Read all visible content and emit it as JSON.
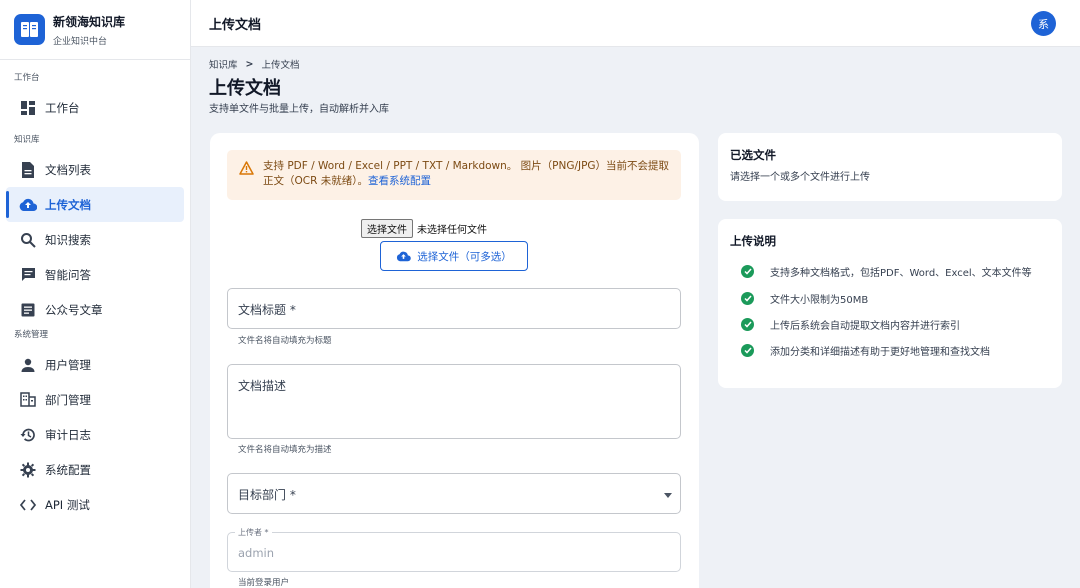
{
  "brand": {
    "name": "新领海知识库",
    "subtitle": "企业知识中台"
  },
  "sidebar": {
    "sections": [
      {
        "label": "工作台"
      },
      {
        "label": "知识库"
      },
      {
        "label": "系统管理"
      }
    ],
    "items": [
      {
        "label": "工作台",
        "icon": "dashboard-icon"
      },
      {
        "label": "文档列表",
        "icon": "document-icon"
      },
      {
        "label": "上传文档",
        "icon": "cloud-upload-icon",
        "active": true
      },
      {
        "label": "知识搜索",
        "icon": "search-icon"
      },
      {
        "label": "智能问答",
        "icon": "chat-icon"
      },
      {
        "label": "公众号文章",
        "icon": "article-icon"
      },
      {
        "label": "用户管理",
        "icon": "person-icon"
      },
      {
        "label": "部门管理",
        "icon": "building-icon"
      },
      {
        "label": "审计日志",
        "icon": "history-icon"
      },
      {
        "label": "系统配置",
        "icon": "gear-icon"
      },
      {
        "label": "API 测试",
        "icon": "code-icon"
      }
    ]
  },
  "topbar": {
    "title": "上传文档",
    "avatar": "系"
  },
  "breadcrumb": {
    "root": "知识库",
    "separator": ">",
    "current": "上传文档"
  },
  "page": {
    "title": "上传文档",
    "subtitle": "支持单文件与批量上传，自动解析并入库"
  },
  "alert": {
    "text": "支持 PDF / Word / Excel / PPT / TXT / Markdown。 图片（PNG/JPG）当前不会提取正文（OCR 未就绪）。",
    "link": "查看系统配置",
    "icon": "warning-icon"
  },
  "upload": {
    "native_button": "选择文件",
    "native_status": "未选择任何文件",
    "pick_button": "选择文件（可多选）"
  },
  "form": {
    "title_label": "文档标题 *",
    "title_helper": "文件名将自动填充为标题",
    "desc_label": "文档描述",
    "desc_helper": "文件名将自动填充为描述",
    "dept_label": "目标部门 *",
    "uploader_label": "上传者 *",
    "uploader_value": "admin",
    "uploader_helper": "当前登录用户"
  },
  "selected": {
    "title": "已选文件",
    "text": "请选择一个或多个文件进行上传"
  },
  "instructions": {
    "title": "上传说明",
    "tips": [
      "支持多种文档格式，包括PDF、Word、Excel、文本文件等",
      "文件大小限制为50MB",
      "上传后系统会自动提取文档内容并进行索引",
      "添加分类和详细描述有助于更好地管理和查找文档"
    ]
  },
  "colors": {
    "primary": "#1e63d6",
    "success": "#1b9a5a",
    "warning_bg": "#fdf1e6",
    "warning": "#d97706"
  }
}
